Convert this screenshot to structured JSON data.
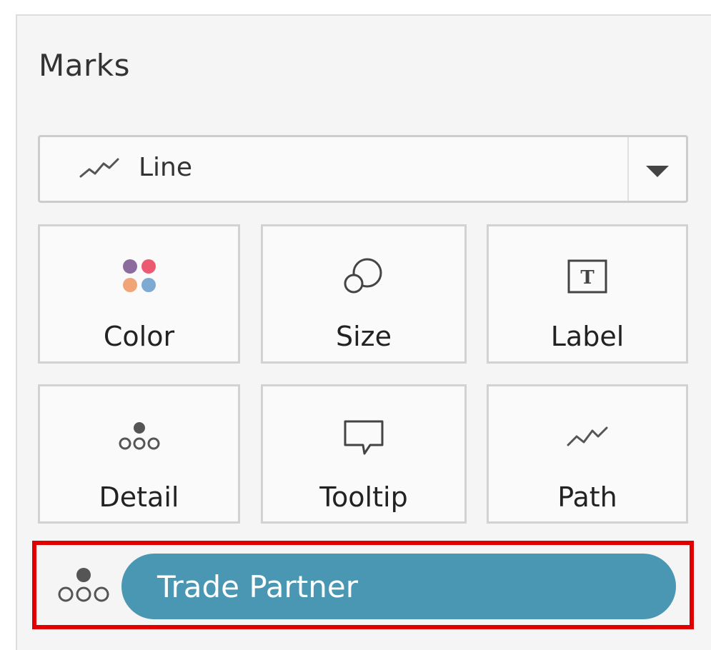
{
  "marks": {
    "title": "Marks",
    "mark_type": {
      "value": "Line",
      "icon": "line-chart-icon"
    },
    "cards": [
      {
        "label": "Color",
        "icon": "color-icon"
      },
      {
        "label": "Size",
        "icon": "size-icon"
      },
      {
        "label": "Label",
        "icon": "label-icon"
      },
      {
        "label": "Detail",
        "icon": "detail-icon"
      },
      {
        "label": "Tooltip",
        "icon": "tooltip-icon"
      },
      {
        "label": "Path",
        "icon": "path-icon"
      }
    ],
    "field_pill": {
      "label": "Trade Partner",
      "icon": "detail-icon",
      "color": "#4a97b3"
    },
    "highlight_color": "#e00000"
  }
}
